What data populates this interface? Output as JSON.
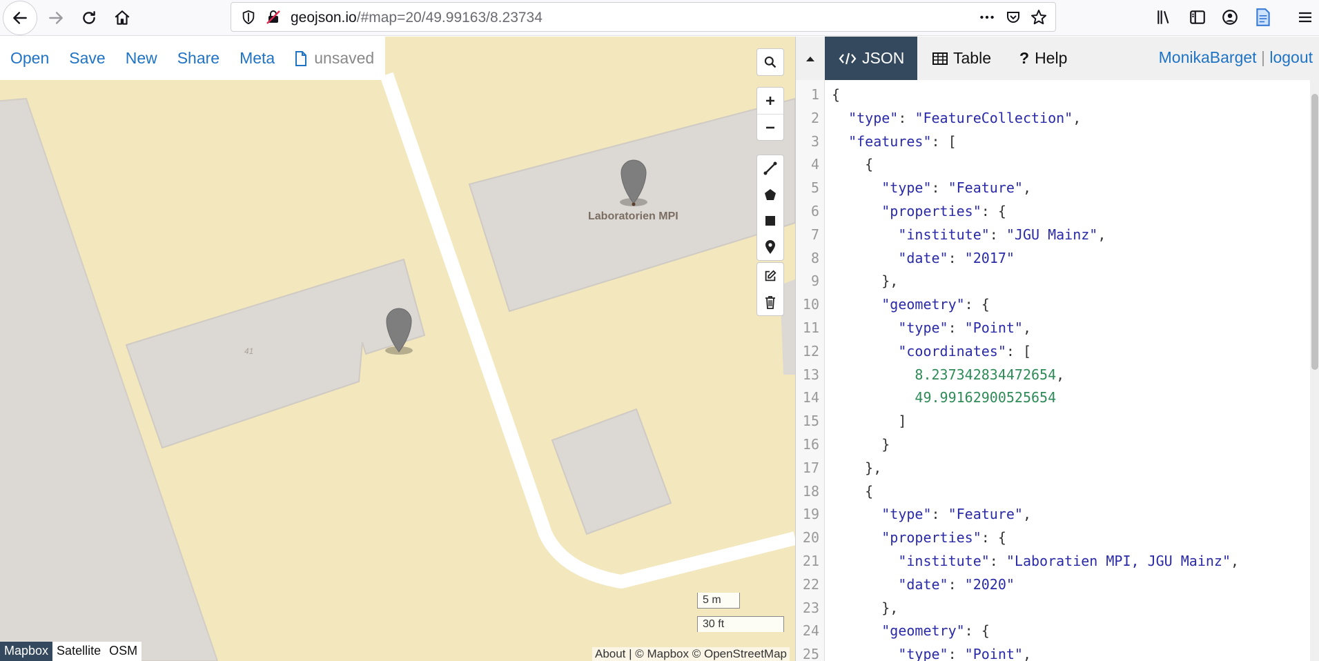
{
  "browser": {
    "url_host": "geojson.io",
    "url_path": "/#map=20/49.99163/8.23734"
  },
  "menu": {
    "open": "Open",
    "save": "Save",
    "new": "New",
    "share": "Share",
    "meta": "Meta",
    "unsaved": "unsaved"
  },
  "map": {
    "label_lab": "Laboratorien MPI",
    "label_building": "41",
    "scale_m": "5 m",
    "scale_ft": "30 ft",
    "layers": [
      "Mapbox",
      "Satellite",
      "OSM"
    ],
    "active_layer": "Mapbox",
    "attribution": "About | © Mapbox © OpenStreetMap",
    "colors": {
      "land": "#f2e7bd",
      "building": "#dcd8d3",
      "road": "#ffffff",
      "marker": "#7e7e7e"
    }
  },
  "panel": {
    "tabs": {
      "json": "JSON",
      "table": "Table",
      "help": "Help"
    },
    "user": "MonikaBarget",
    "separator": "|",
    "logout": "logout",
    "accent": "#34495e"
  },
  "code_lines": [
    "{",
    "  \"type\": \"FeatureCollection\",",
    "  \"features\": [",
    "    {",
    "      \"type\": \"Feature\",",
    "      \"properties\": {",
    "        \"institute\": \"JGU Mainz\",",
    "        \"date\": \"2017\"",
    "      },",
    "      \"geometry\": {",
    "        \"type\": \"Point\",",
    "        \"coordinates\": [",
    "          8.237342834472654,",
    "          49.99162900525654",
    "        ]",
    "      }",
    "    },",
    "    {",
    "      \"type\": \"Feature\",",
    "      \"properties\": {",
    "        \"institute\": \"Laboratien MPI, JGU Mainz\",",
    "        \"date\": \"2020\"",
    "      },",
    "      \"geometry\": {",
    "        \"type\": \"Point\","
  ]
}
